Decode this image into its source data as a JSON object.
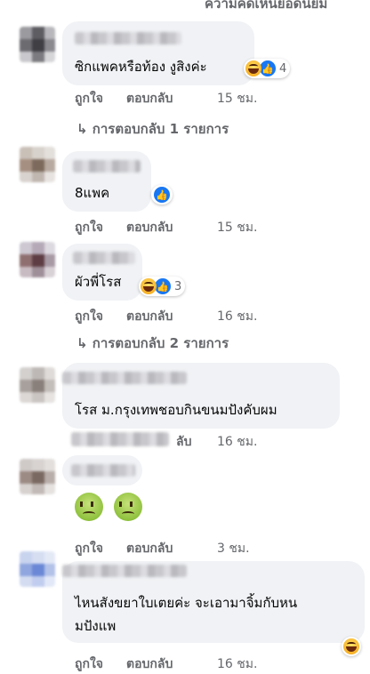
{
  "header": {
    "partial_text": "ความคิดเห็นยอดนิยม"
  },
  "labels": {
    "like": "ถูกใจ",
    "reply": "ตอบกลับ"
  },
  "comments": [
    {
      "text": "ซิกแพคหรือท้อง งูสิงค่ะ",
      "reaction_count": "4",
      "time": "15 ชม.",
      "replies_link": "↳ การตอบกลับ 1 รายการ"
    },
    {
      "text": "8แพค",
      "time": "15 ชม."
    },
    {
      "text": "ผัวพี่โรส",
      "reaction_count": "3",
      "time": "16 ชม.",
      "replies_link": "↳ การตอบกลับ 2 รายการ"
    },
    {
      "text": "โรส ม.กรุงเทพชอบกินขนมปังคับผม",
      "time": "16 ชม.",
      "partial_reply": "ลับ"
    },
    {
      "text": "",
      "time": "3 ชม."
    },
    {
      "text_line1": "ไหนสังขยาใบเตยค่ะ จะเอามาจิ้มกับหน",
      "text_line2": "มปังแพ",
      "time": "16 ชม."
    }
  ],
  "colors": {
    "bubble": "#f0f2f5",
    "meta_gray": "#65676b",
    "like_blue": "#1877f2"
  }
}
